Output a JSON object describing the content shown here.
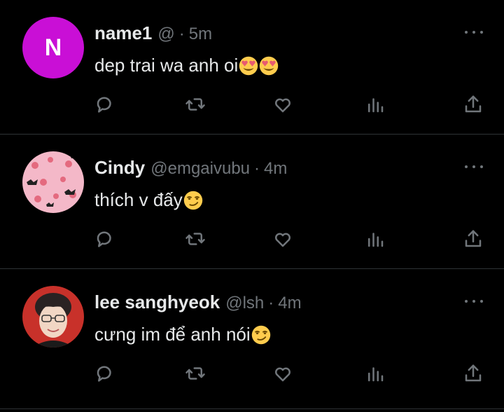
{
  "tweets": [
    {
      "name": "name1",
      "handle": "@",
      "dot": "·",
      "time": "5m",
      "text": "dep trai wa anh oi",
      "emojis": [
        "heart-eyes-emoji",
        "heart-eyes-emoji"
      ],
      "avatar": {
        "type": "letter",
        "letter": "N",
        "color": "#c90fd6"
      }
    },
    {
      "name": "Cindy",
      "handle": "@emgaivubu",
      "dot": "·",
      "time": "4m",
      "text": "thích v đấy",
      "emojis": [
        "smirk-emoji"
      ],
      "avatar": {
        "type": "pattern",
        "color": "#f4b8c8"
      }
    },
    {
      "name": "lee sanghyeok",
      "handle": "@lsh",
      "dot": "·",
      "time": "4m",
      "text": "cưng im để anh nói",
      "emojis": [
        "smirk-emoji"
      ],
      "avatar": {
        "type": "photo",
        "color": "#c8312a"
      }
    }
  ],
  "icons": {
    "reply": "reply-icon",
    "retweet": "retweet-icon",
    "like": "heart-icon",
    "views": "views-icon",
    "share": "share-icon",
    "more": "more-icon"
  },
  "colors": {
    "background": "#000000",
    "text": "#e7e9ea",
    "muted": "#71767b",
    "divider": "#2f3336"
  }
}
